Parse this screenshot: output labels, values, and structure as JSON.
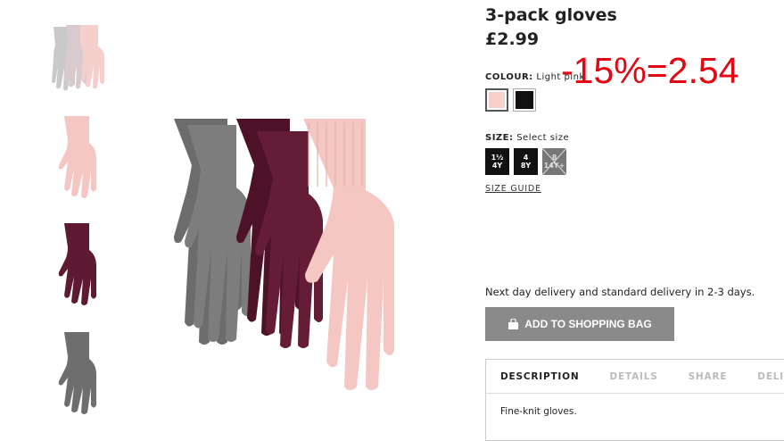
{
  "product": {
    "title": "3-pack gloves",
    "price": "£2.99"
  },
  "colour": {
    "label": "COLOUR:",
    "value": "Light pink",
    "options": [
      {
        "name": "Light pink",
        "hex": "#f7cfcb",
        "selected": true
      },
      {
        "name": "Black",
        "hex": "#111111",
        "selected": false
      }
    ]
  },
  "size": {
    "label": "SIZE:",
    "value": "Select size",
    "options": [
      {
        "line1": "1½",
        "line2": "4Y",
        "available": true
      },
      {
        "line1": "4",
        "line2": "8Y",
        "available": true
      },
      {
        "line1": "8",
        "line2": "14Y+",
        "available": false
      }
    ]
  },
  "size_guide": "SIZE GUIDE",
  "annotation": "-15%=2.54",
  "delivery": "Next day delivery and standard delivery in 2-3 days.",
  "add_to_bag": "ADD TO SHOPPING BAG",
  "tabs": [
    "DESCRIPTION",
    "DETAILS",
    "SHARE",
    "DELIVE"
  ],
  "description": "Fine-knit gloves.",
  "colors": {
    "pink": "#f4c7c3",
    "grey": "#6e6e6e",
    "burgundy": "#5e1a33",
    "annotation_red": "#e30613",
    "button_grey": "#8a8a8a"
  }
}
